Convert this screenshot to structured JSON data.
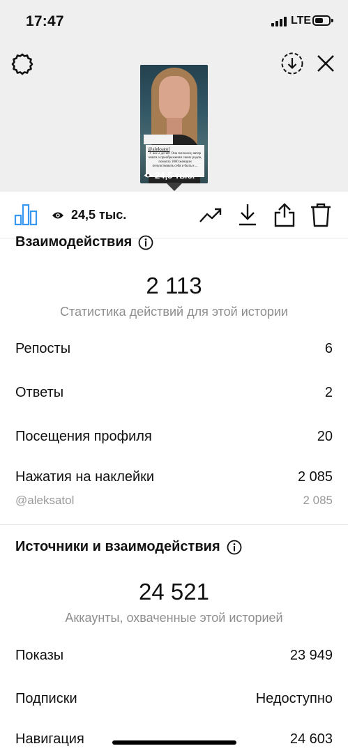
{
  "status_bar": {
    "time": "17:47",
    "network": "LTE"
  },
  "story": {
    "views": "24,5 тыс.",
    "sticker_handle": "@aleksatol",
    "sticker_text": "У нее 2 детей! Она психолог, автор книги о преображении своих родов, помогла 1000 женщин почувствовать себя и быть в ..."
  },
  "toolbar": {
    "views_count": "24,5 тыс."
  },
  "interactions": {
    "title": "Взаимодействия",
    "total": "2 113",
    "subtitle": "Статистика действий для этой истории",
    "rows": [
      {
        "label": "Репосты",
        "value": "6"
      },
      {
        "label": "Ответы",
        "value": "2"
      },
      {
        "label": "Посещения профиля",
        "value": "20"
      },
      {
        "label": "Нажатия на наклейки",
        "value": "2 085"
      }
    ],
    "sticker_row": {
      "label": "@aleksatol",
      "value": "2 085"
    }
  },
  "discovery": {
    "title": "Источники и взаимодействия",
    "total": "24 521",
    "subtitle": "Аккаунты, охваченные этой историей",
    "rows": [
      {
        "label": "Показы",
        "value": "23 949"
      },
      {
        "label": "Подписки",
        "value": "Недоступно"
      },
      {
        "label": "Навигация",
        "value": "24 603"
      }
    ]
  }
}
